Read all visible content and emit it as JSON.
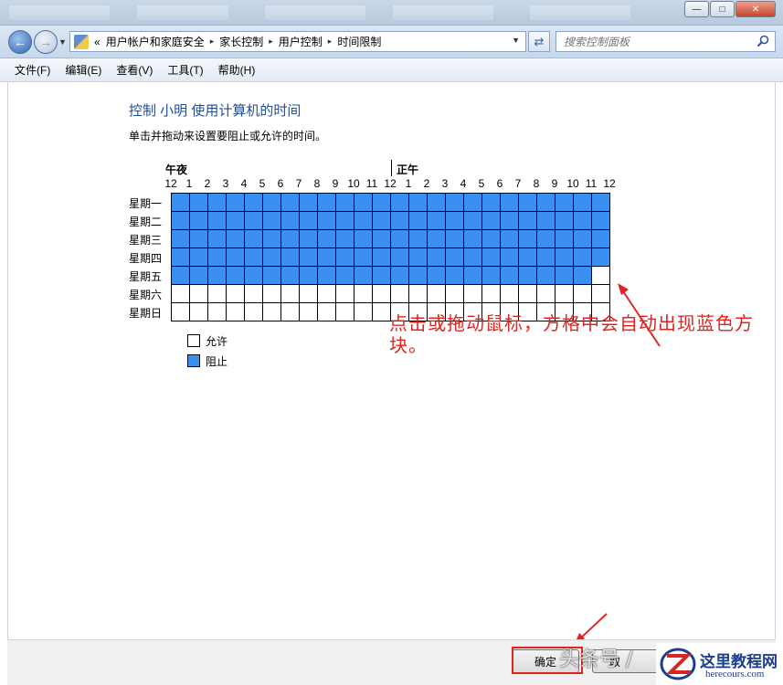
{
  "window": {
    "minimize_glyph": "—",
    "maximize_glyph": "□",
    "close_glyph": "✕"
  },
  "address": {
    "prefix": "«",
    "crumbs": [
      "用户帐户和家庭安全",
      "家长控制",
      "用户控制",
      "时间限制"
    ],
    "separator_glyph": "▸",
    "search_placeholder": "搜索控制面板"
  },
  "menu": [
    "文件(F)",
    "编辑(E)",
    "查看(V)",
    "工具(T)",
    "帮助(H)"
  ],
  "page": {
    "title": "控制 小明 使用计算机的时间",
    "description": "单击并拖动来设置要阻止或允许的时间。"
  },
  "grid": {
    "midnight_label": "午夜",
    "noon_label": "正午",
    "hours": [
      "12",
      "1",
      "2",
      "3",
      "4",
      "5",
      "6",
      "7",
      "8",
      "9",
      "10",
      "11",
      "12",
      "1",
      "2",
      "3",
      "4",
      "5",
      "6",
      "7",
      "8",
      "9",
      "10",
      "11",
      "12"
    ],
    "days": [
      {
        "label": "星期一",
        "blocked_hours": 24
      },
      {
        "label": "星期二",
        "blocked_hours": 24
      },
      {
        "label": "星期三",
        "blocked_hours": 24
      },
      {
        "label": "星期四",
        "blocked_hours": 24
      },
      {
        "label": "星期五",
        "blocked_hours": 23
      },
      {
        "label": "星期六",
        "blocked_hours": 0
      },
      {
        "label": "星期日",
        "blocked_hours": 0
      }
    ]
  },
  "legend": {
    "allow": "允许",
    "block": "阻止"
  },
  "annotation": "点击或拖动鼠标，方格中会自动出现蓝色方块。",
  "buttons": {
    "ok": "确定",
    "cancel": "取"
  },
  "watermark": {
    "text": "头条号 /",
    "logo_cn": "这里教程网",
    "logo_en": "herecours.com"
  },
  "colors": {
    "blocked": "#3b8ff0",
    "title": "#1e4e9a",
    "annotation": "#e0251f"
  }
}
